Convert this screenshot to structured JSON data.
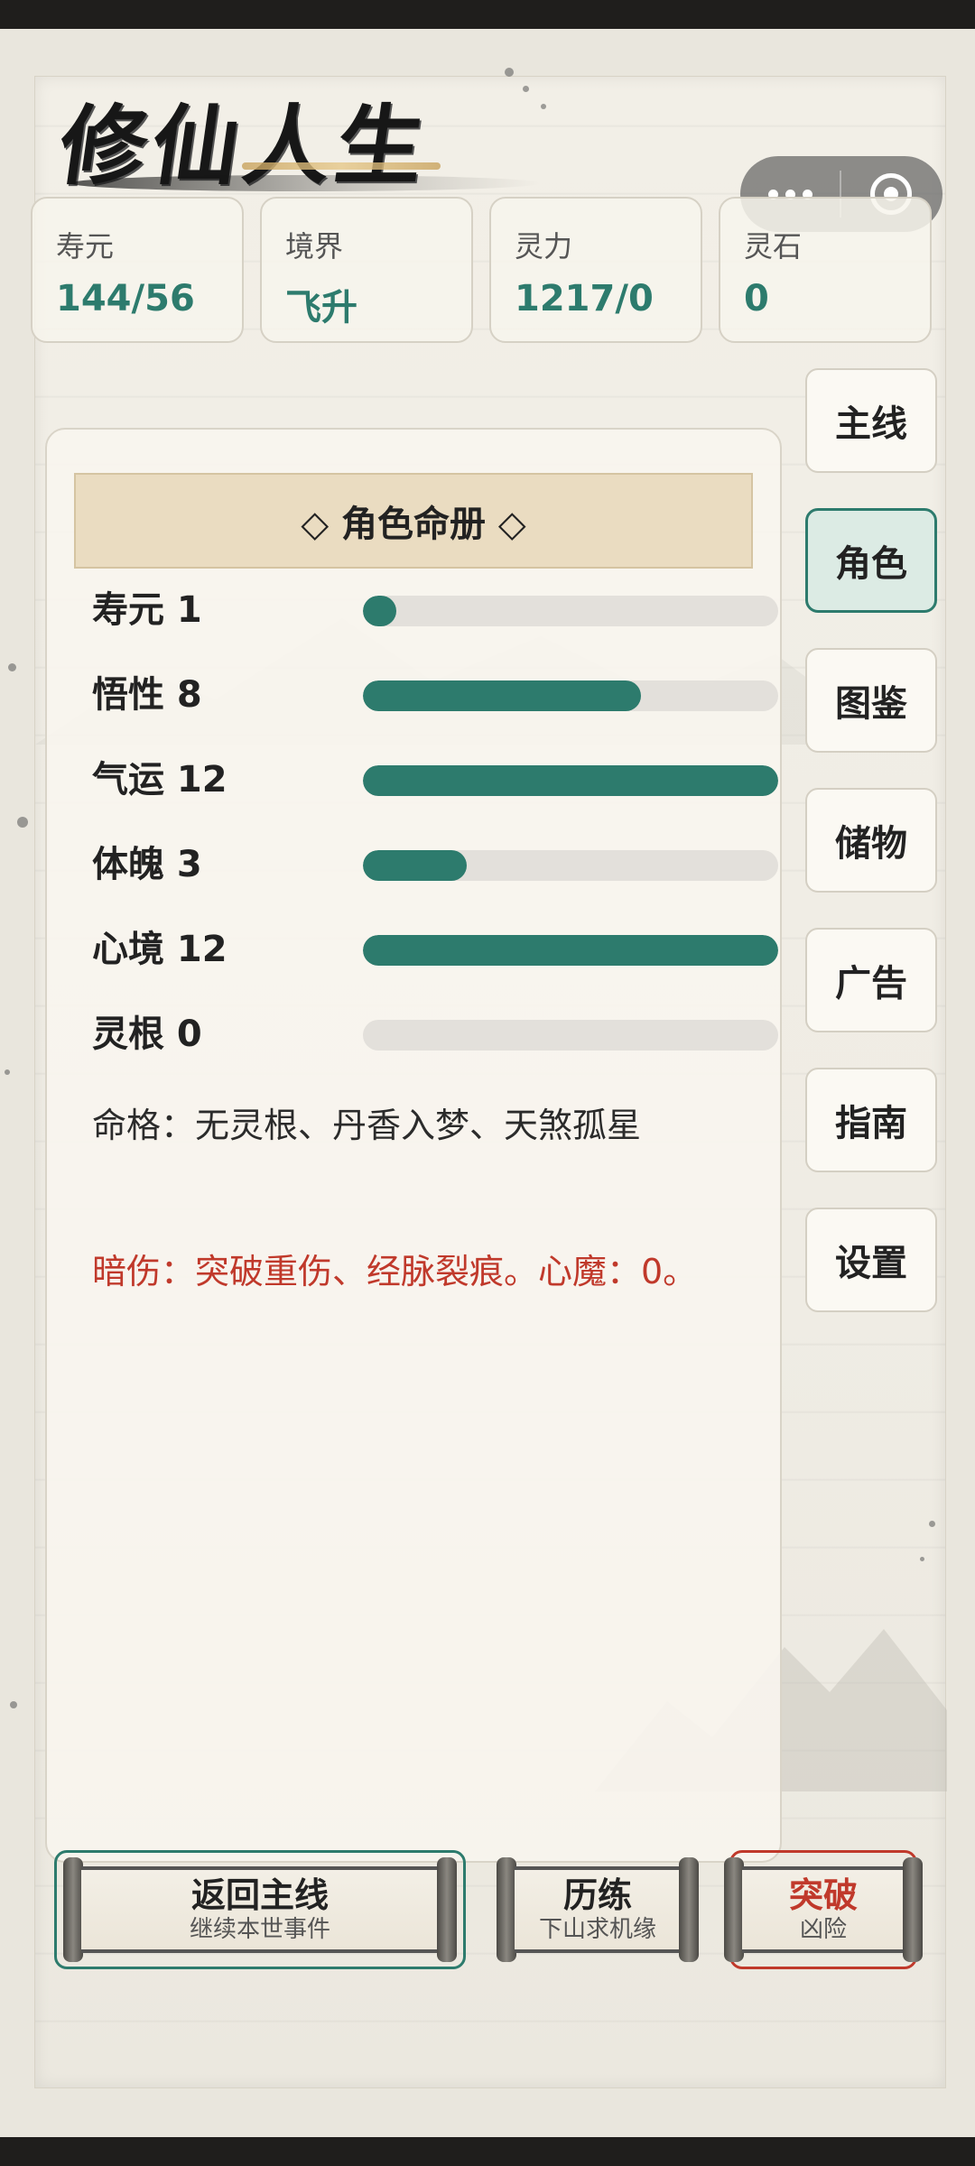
{
  "app": {
    "logo_text": "修仙人生"
  },
  "capsule": {
    "more_icon": "more-dots-icon",
    "close_icon": "target-circle-icon"
  },
  "stats": [
    {
      "label": "寿元",
      "value": "144/56"
    },
    {
      "label": "境界",
      "value": "飞升"
    },
    {
      "label": "灵力",
      "value": "1217/0"
    },
    {
      "label": "灵石",
      "value": "0"
    }
  ],
  "panel": {
    "title": "◇ 角色命册 ◇",
    "attributes": [
      {
        "label": "寿元 1",
        "fill": 0.08
      },
      {
        "label": "悟性 8",
        "fill": 0.67
      },
      {
        "label": "气运 12",
        "fill": 1.0
      },
      {
        "label": "体魄 3",
        "fill": 0.25
      },
      {
        "label": "心境 12",
        "fill": 1.0
      },
      {
        "label": "灵根 0",
        "fill": 0.0
      }
    ],
    "fate": "命格：无灵根、丹香入梦、天煞孤星",
    "injury": "暗伤：突破重伤、经脉裂痕。心魔：0。"
  },
  "nav": [
    {
      "label": "主线",
      "active": false
    },
    {
      "label": "角色",
      "active": true
    },
    {
      "label": "图鉴",
      "active": false
    },
    {
      "label": "储物",
      "active": false
    },
    {
      "label": "广告",
      "active": false
    },
    {
      "label": "指南",
      "active": false
    },
    {
      "label": "设置",
      "active": false
    }
  ],
  "actions": [
    {
      "title": "返回主线",
      "subtitle": "继续本世事件"
    },
    {
      "title": "历练",
      "subtitle": "下山求机缘"
    },
    {
      "title": "突破",
      "subtitle": "凶险"
    }
  ],
  "colors": {
    "accent": "#2d7b6d",
    "danger": "#c0392b",
    "header_bg": "#eadcc1"
  }
}
